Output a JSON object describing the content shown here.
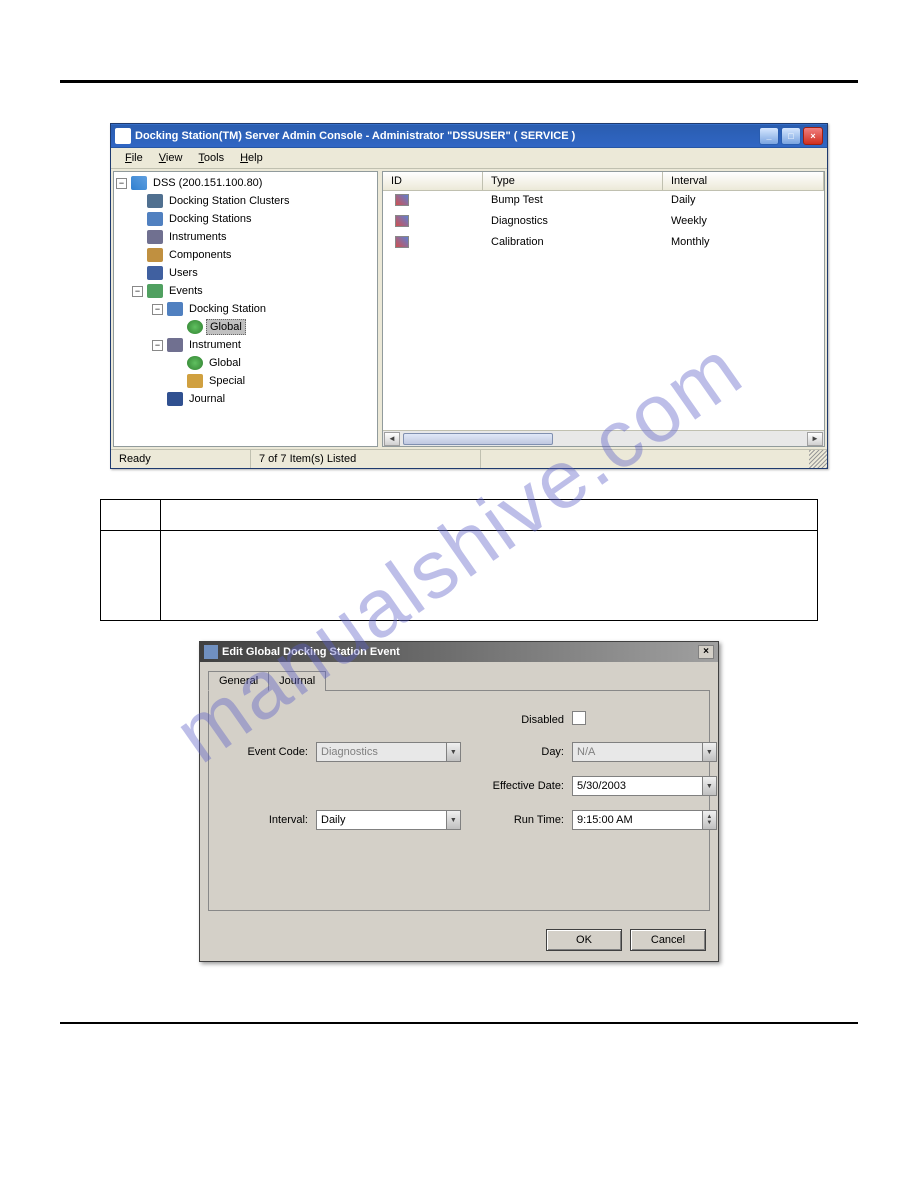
{
  "watermark": "manualshive.com",
  "window1": {
    "title": "Docking Station(TM) Server Admin Console - Administrator \"DSSUSER\" ( SERVICE )",
    "menus": {
      "file": "File",
      "view": "View",
      "tools": "Tools",
      "help": "Help"
    },
    "tree": {
      "root": "DSS (200.151.100.80)",
      "children": {
        "clusters": "Docking Station Clusters",
        "docking": "Docking Stations",
        "instruments": "Instruments",
        "components": "Components",
        "users": "Users",
        "events": "Events",
        "events_children": {
          "docking": "Docking Station",
          "docking_children": {
            "global": "Global"
          },
          "instrument": "Instrument",
          "instrument_children": {
            "global": "Global",
            "special": "Special"
          },
          "journal": "Journal"
        }
      }
    },
    "columns": {
      "id": "ID",
      "type": "Type",
      "interval": "Interval"
    },
    "rows": [
      {
        "type": "Bump Test",
        "interval": "Daily"
      },
      {
        "type": "Diagnostics",
        "interval": "Weekly"
      },
      {
        "type": "Calibration",
        "interval": "Monthly"
      }
    ],
    "status": {
      "ready": "Ready",
      "items": "7 of 7 Item(s) Listed"
    }
  },
  "dialog": {
    "title": "Edit Global Docking Station Event",
    "tabs": {
      "general": "General",
      "journal": "Journal"
    },
    "labels": {
      "disabled": "Disabled",
      "event_code": "Event Code:",
      "day": "Day:",
      "effective_date": "Effective Date:",
      "interval": "Interval:",
      "run_time": "Run Time:"
    },
    "values": {
      "event_code": "Diagnostics",
      "day": "N/A",
      "effective_date": "5/30/2003",
      "interval": "Daily",
      "run_time": "9:15:00 AM"
    },
    "buttons": {
      "ok": "OK",
      "cancel": "Cancel"
    }
  }
}
